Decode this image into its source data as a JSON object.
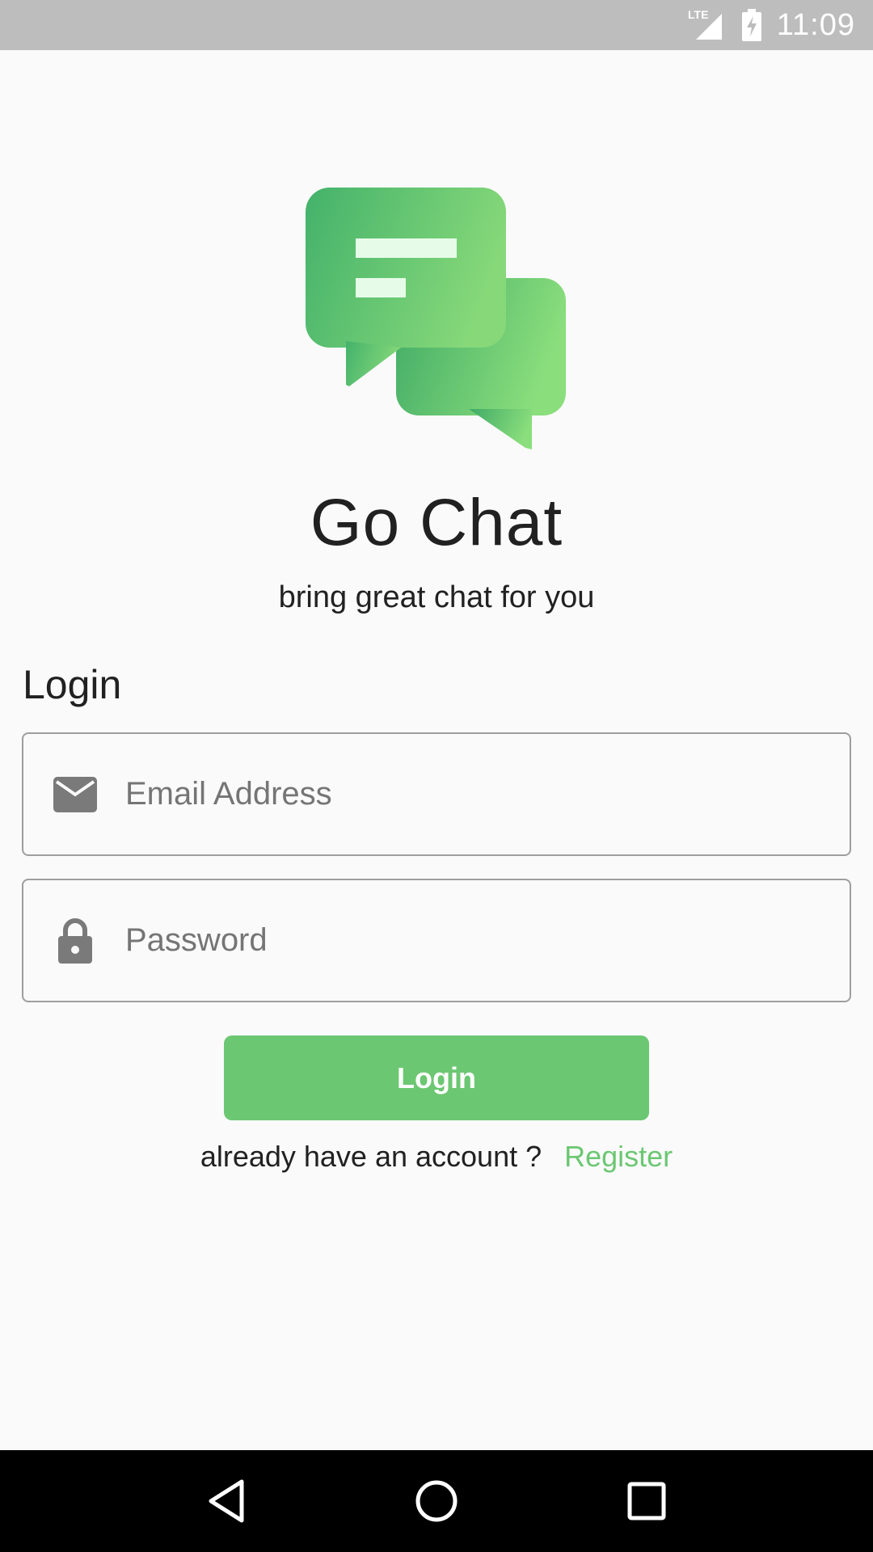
{
  "status_bar": {
    "network_label": "LTE",
    "time": "11:09",
    "icons": [
      "signal-icon",
      "battery-charging-icon"
    ]
  },
  "app": {
    "logo_icon": "chat-bubbles-icon",
    "name": "Go Chat",
    "tagline": "bring great chat for you"
  },
  "form": {
    "title": "Login",
    "email": {
      "placeholder": "Email Address",
      "value": "",
      "icon": "mail-icon"
    },
    "password": {
      "placeholder": "Password",
      "value": "",
      "icon": "lock-icon"
    },
    "submit_label": "Login"
  },
  "register": {
    "prompt": "already have an account ?",
    "link_label": "Register"
  },
  "nav_bar": {
    "icons": [
      "back-icon",
      "home-icon",
      "recents-icon"
    ]
  },
  "colors": {
    "accent": "#6cc773",
    "background": "#fafafa",
    "status_bar": "#bdbdbd",
    "nav_bar": "#000000"
  }
}
